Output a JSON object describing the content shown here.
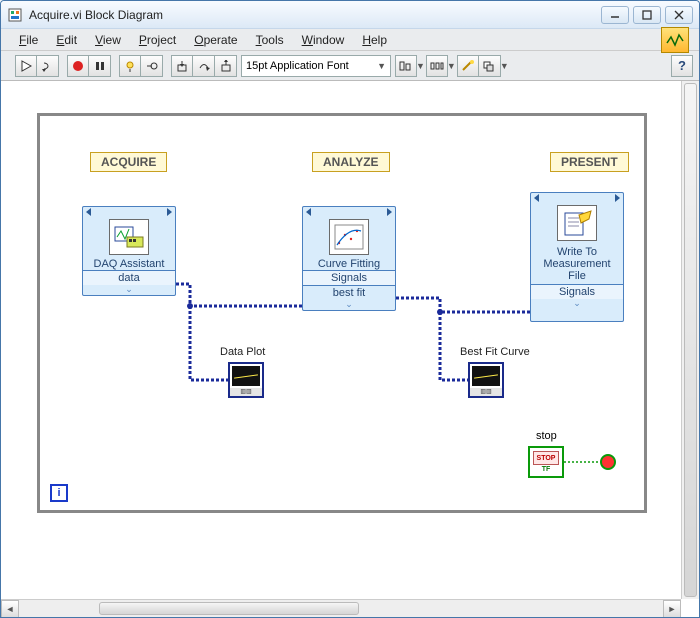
{
  "window": {
    "title": "Acquire.vi Block Diagram"
  },
  "menu": {
    "file": "File",
    "edit": "Edit",
    "view": "View",
    "project": "Project",
    "operate": "Operate",
    "tools": "Tools",
    "window": "Window",
    "help": "Help"
  },
  "toolbar": {
    "font": "15pt Application Font"
  },
  "sections": {
    "acquire": "ACQUIRE",
    "analyze": "ANALYZE",
    "present": "PRESENT"
  },
  "vi": {
    "daq": {
      "title": "DAQ Assistant",
      "out0": "data"
    },
    "curve": {
      "title": "Curve Fitting",
      "in0": "Signals",
      "out0": "best fit"
    },
    "write": {
      "title": "Write To Measurement File",
      "in0": "Signals"
    }
  },
  "indicators": {
    "dataPlot": "Data Plot",
    "bestFit": "Best Fit Curve"
  },
  "stop": {
    "label": "stop",
    "button": "STOP",
    "tf": "TF"
  },
  "iteration": "i"
}
